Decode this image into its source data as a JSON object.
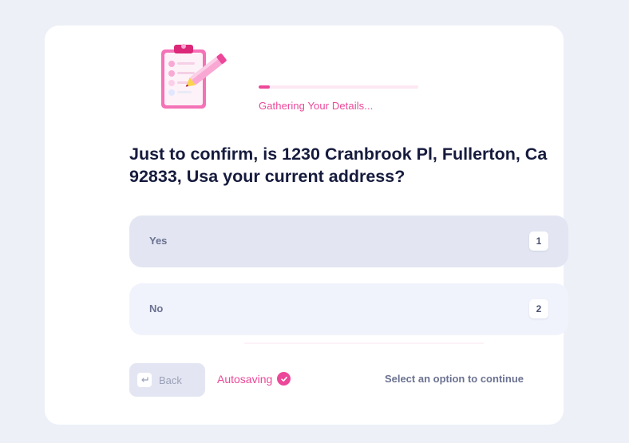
{
  "illustration": {
    "icon": "clipboard-pencil-icon"
  },
  "progress": {
    "fraction": 0.07,
    "label": "Gathering Your Details..."
  },
  "question": "Just to confirm, is 1230 Cranbrook Pl, Fullerton, Ca 92833, Usa your current address?",
  "options": [
    {
      "label": "Yes",
      "key": "1"
    },
    {
      "label": "No",
      "key": "2"
    }
  ],
  "footer": {
    "back_label": "Back",
    "back_icon": "return-key-icon",
    "autosave_label": "Autosaving",
    "autosave_icon": "check-circle-icon",
    "hint": "Select an option to continue"
  },
  "colors": {
    "accent": "#ec4899",
    "heading": "#161b3d",
    "background": "#eef0f8",
    "option_selected_bg": "#e3e6f2",
    "option_bg": "#f1f3fc"
  }
}
